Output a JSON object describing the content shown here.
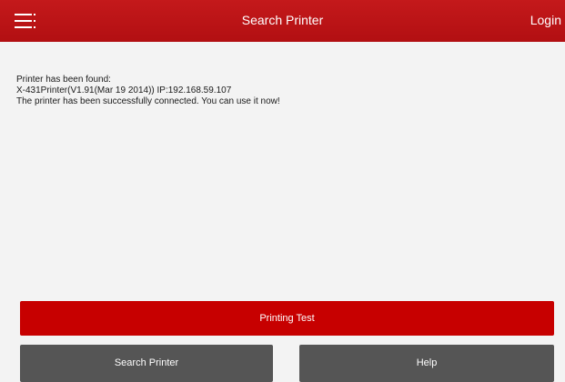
{
  "header": {
    "title": "Search Printer",
    "login_label": "Login",
    "menu_icon": "menu-icon",
    "bar_color": "#bd1416"
  },
  "main": {
    "messages": [
      "Printer has been found:",
      "X-431Printer(V1.91(Mar 19 2014))  IP:192.168.59.107",
      "The printer has been successfully connected. You can use it now!"
    ]
  },
  "buttons": {
    "printing_test_label": "Printing Test",
    "search_printer_label": "Search Printer",
    "help_label": "Help",
    "primary_color": "#c70000",
    "secondary_color": "#555555"
  }
}
